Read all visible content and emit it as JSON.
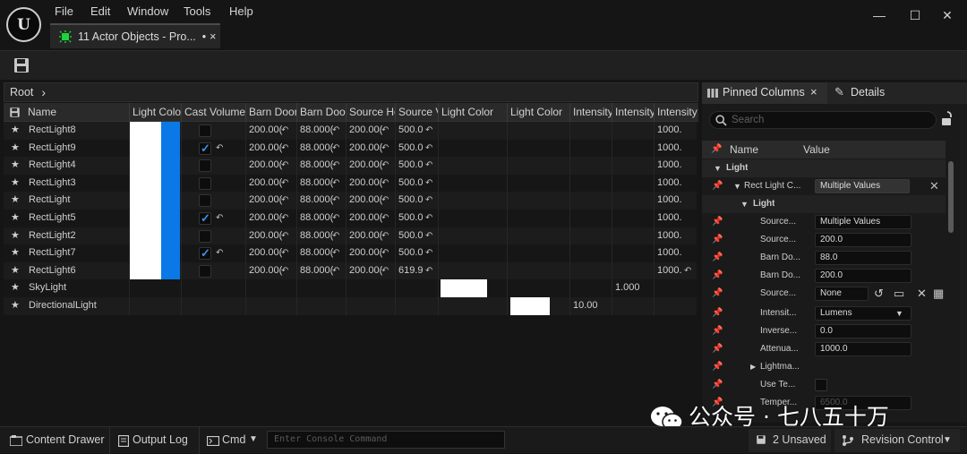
{
  "window": {
    "menu": [
      "File",
      "Edit",
      "Window",
      "Tools",
      "Help"
    ],
    "tab_title": "11 Actor Objects - Pro...",
    "tab_modified": "•",
    "tab_close": "×"
  },
  "breadcrumb": {
    "root": "Root",
    "chevron": "›"
  },
  "table": {
    "columns": [
      "Name",
      "Light Colo",
      "Cast Volumet",
      "Barn Door",
      "Barn Door",
      "Source He",
      "Source V",
      "Light Color",
      "Light Color",
      "Intensity",
      "Intensity",
      "Intensity"
    ],
    "rows": [
      {
        "name": "RectLight8",
        "cast": false,
        "cast_undo": false,
        "barn1": "200.00(",
        "barn2": "88.000(",
        "srch": "200.00(",
        "srcv": "500.0",
        "intensity3": "1000.",
        "int3_undo": false
      },
      {
        "name": "RectLight9",
        "cast": true,
        "cast_undo": true,
        "barn1": "200.00(",
        "barn2": "88.000(",
        "srch": "200.00(",
        "srcv": "500.0",
        "intensity3": "1000.",
        "int3_undo": false
      },
      {
        "name": "RectLight4",
        "cast": false,
        "cast_undo": false,
        "barn1": "200.00(",
        "barn2": "88.000(",
        "srch": "200.00(",
        "srcv": "500.0",
        "intensity3": "1000.",
        "int3_undo": false
      },
      {
        "name": "RectLight3",
        "cast": false,
        "cast_undo": false,
        "barn1": "200.00(",
        "barn2": "88.000(",
        "srch": "200.00(",
        "srcv": "500.0",
        "intensity3": "1000.",
        "int3_undo": false
      },
      {
        "name": "RectLight",
        "cast": false,
        "cast_undo": false,
        "barn1": "200.00(",
        "barn2": "88.000(",
        "srch": "200.00(",
        "srcv": "500.0",
        "intensity3": "1000.",
        "int3_undo": false
      },
      {
        "name": "RectLight5",
        "cast": true,
        "cast_undo": true,
        "barn1": "200.00(",
        "barn2": "88.000(",
        "srch": "200.00(",
        "srcv": "500.0",
        "intensity3": "1000.",
        "int3_undo": false
      },
      {
        "name": "RectLight2",
        "cast": false,
        "cast_undo": false,
        "barn1": "200.00(",
        "barn2": "88.000(",
        "srch": "200.00(",
        "srcv": "500.0",
        "intensity3": "1000.",
        "int3_undo": false
      },
      {
        "name": "RectLight7",
        "cast": true,
        "cast_undo": true,
        "barn1": "200.00(",
        "barn2": "88.000(",
        "srch": "200.00(",
        "srcv": "500.0",
        "intensity3": "1000.",
        "int3_undo": false
      },
      {
        "name": "RectLight6",
        "cast": false,
        "cast_undo": false,
        "barn1": "200.00(",
        "barn2": "88.000(",
        "srch": "200.00(",
        "srcv": "619.9",
        "intensity3": "1000.",
        "int3_undo": true
      }
    ],
    "skylight": {
      "name": "SkyLight",
      "intensity2": "1.000"
    },
    "directional": {
      "name": "DirectionalLight",
      "intensity1": "10.00"
    },
    "undo_glyph": "↶",
    "swatch_white": "#ffffff",
    "swatch_blue": "#0a78e6"
  },
  "right": {
    "tab_pinned": "Pinned Columns",
    "tab_close": "×",
    "tab_details": "Details",
    "search_placeholder": "Search",
    "hdr_name": "Name",
    "hdr_value": "Value",
    "section_light": "Light",
    "rect_light_label": "Rect Light C...",
    "rect_light_value": "Multiple Values",
    "sub_light": "Light",
    "props": [
      {
        "label": "Source...",
        "value": "Multiple Values"
      },
      {
        "label": "Source...",
        "value": "200.0"
      },
      {
        "label": "Barn Do...",
        "value": "88.0"
      },
      {
        "label": "Barn Do...",
        "value": "200.0"
      },
      {
        "label": "Source...",
        "value": "None"
      },
      {
        "label": "Intensit...",
        "value": "Lumens"
      },
      {
        "label": "Inverse...",
        "value": "0.0"
      },
      {
        "label": "Attenua...",
        "value": "1000.0"
      },
      {
        "label": "Lightma...",
        "value": ""
      },
      {
        "label": "Use Te...",
        "value": ""
      },
      {
        "label": "Temper...",
        "value": "6500.0"
      }
    ]
  },
  "status": {
    "content_drawer": "Content Drawer",
    "output_log": "Output Log",
    "cmd": "Cmd",
    "console_placeholder": "Enter Console Command",
    "unsaved": "2 Unsaved",
    "revision": "Revision Control"
  },
  "watermark": "公众号 · 七八五十万"
}
